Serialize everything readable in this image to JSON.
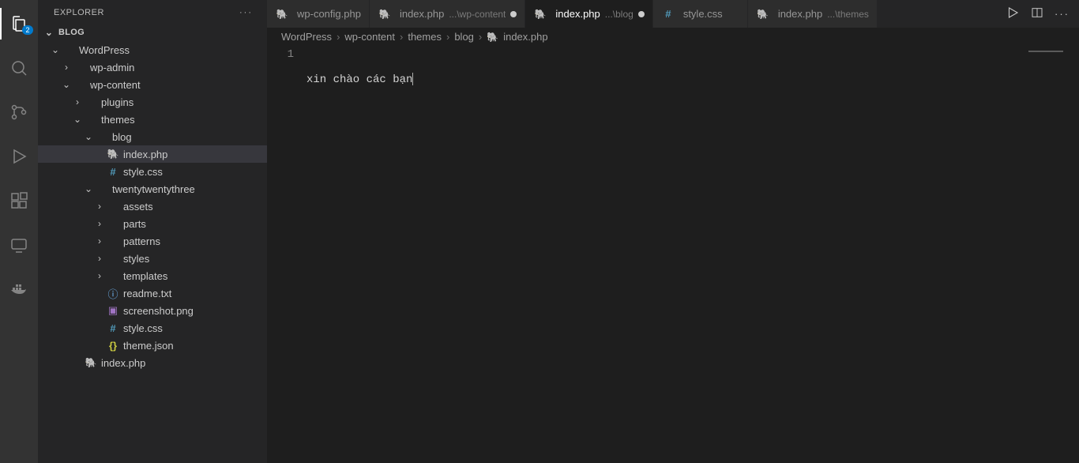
{
  "sidebar": {
    "title": "EXPLORER",
    "panelTitle": "BLOG",
    "badge": "2"
  },
  "tree": [
    {
      "depth": 0,
      "chev": "down",
      "icon": "",
      "label": "WordPress",
      "sel": false
    },
    {
      "depth": 1,
      "chev": "right",
      "icon": "",
      "label": "wp-admin",
      "sel": false
    },
    {
      "depth": 1,
      "chev": "down",
      "icon": "",
      "label": "wp-content",
      "sel": false
    },
    {
      "depth": 2,
      "chev": "right",
      "icon": "",
      "label": "plugins",
      "sel": false
    },
    {
      "depth": 2,
      "chev": "down",
      "icon": "",
      "label": "themes",
      "sel": false
    },
    {
      "depth": 3,
      "chev": "down",
      "icon": "",
      "label": "blog",
      "sel": false
    },
    {
      "depth": 4,
      "chev": "",
      "icon": "php",
      "label": "index.php",
      "sel": true
    },
    {
      "depth": 4,
      "chev": "",
      "icon": "hash",
      "label": "style.css",
      "sel": false
    },
    {
      "depth": 3,
      "chev": "down",
      "icon": "",
      "label": "twentytwentythree",
      "sel": false
    },
    {
      "depth": 4,
      "chev": "right",
      "icon": "",
      "label": "assets",
      "sel": false
    },
    {
      "depth": 4,
      "chev": "right",
      "icon": "",
      "label": "parts",
      "sel": false
    },
    {
      "depth": 4,
      "chev": "right",
      "icon": "",
      "label": "patterns",
      "sel": false
    },
    {
      "depth": 4,
      "chev": "right",
      "icon": "",
      "label": "styles",
      "sel": false
    },
    {
      "depth": 4,
      "chev": "right",
      "icon": "",
      "label": "templates",
      "sel": false
    },
    {
      "depth": 4,
      "chev": "",
      "icon": "info",
      "label": "readme.txt",
      "sel": false
    },
    {
      "depth": 4,
      "chev": "",
      "icon": "img",
      "label": "screenshot.png",
      "sel": false
    },
    {
      "depth": 4,
      "chev": "",
      "icon": "hash",
      "label": "style.css",
      "sel": false
    },
    {
      "depth": 4,
      "chev": "",
      "icon": "json",
      "label": "theme.json",
      "sel": false
    },
    {
      "depth": 2,
      "chev": "",
      "icon": "php",
      "label": "index.php",
      "sel": false
    }
  ],
  "tabs": [
    {
      "icon": "php",
      "name": "wp-config.php",
      "suffix": "",
      "dirty": false,
      "active": false
    },
    {
      "icon": "php",
      "name": "index.php",
      "suffix": "...\\wp-content",
      "dirty": true,
      "active": false
    },
    {
      "icon": "php",
      "name": "index.php",
      "suffix": "...\\blog",
      "dirty": true,
      "active": true
    },
    {
      "icon": "hash",
      "name": "style.css",
      "suffix": "",
      "dirty": false,
      "active": false
    },
    {
      "icon": "php",
      "name": "index.php",
      "suffix": "...\\themes",
      "dirty": false,
      "active": false
    }
  ],
  "breadcrumbs": [
    "WordPress",
    "wp-content",
    "themes",
    "blog",
    "index.php"
  ],
  "editor": {
    "lineNumber": "1",
    "content": "xin chào các bạn"
  }
}
